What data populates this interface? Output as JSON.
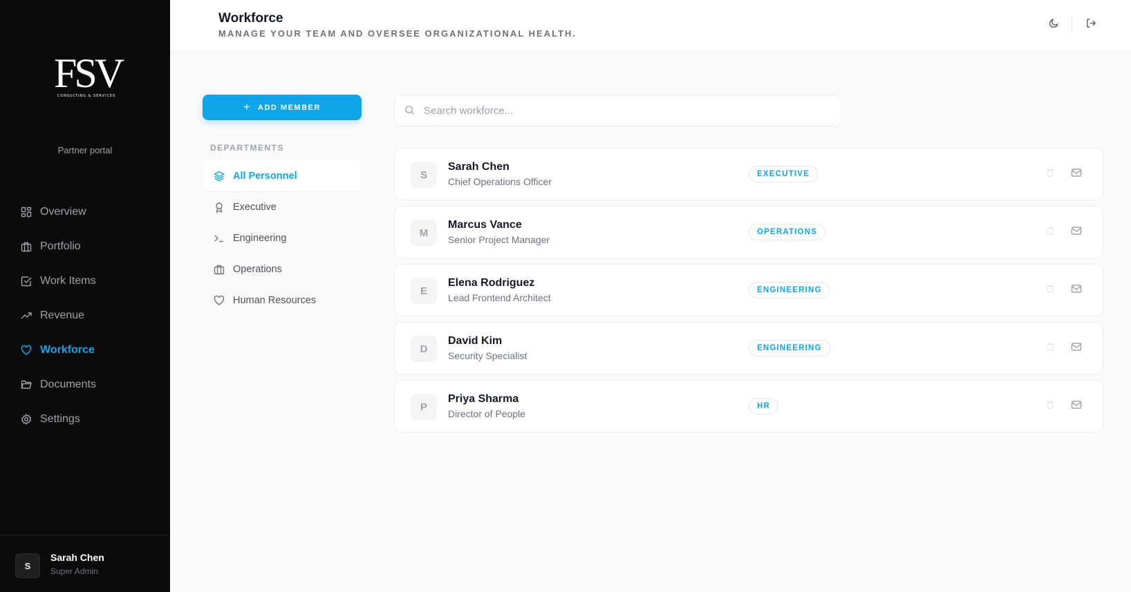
{
  "sidebar": {
    "logo_text": "FSV",
    "logo_subtext": "CONSULTING & SERVICES",
    "partner_label": "Partner portal",
    "nav": [
      {
        "label": "Overview",
        "icon": "grid-icon"
      },
      {
        "label": "Portfolio",
        "icon": "briefcase-icon"
      },
      {
        "label": "Work Items",
        "icon": "checkbox-icon"
      },
      {
        "label": "Revenue",
        "icon": "trending-up-icon"
      },
      {
        "label": "Workforce",
        "icon": "heart-icon",
        "active": true
      },
      {
        "label": "Documents",
        "icon": "folder-icon"
      },
      {
        "label": "Settings",
        "icon": "gear-icon"
      }
    ],
    "user": {
      "initial": "S",
      "name": "Sarah Chen",
      "role": "Super Admin"
    }
  },
  "header": {
    "title": "Workforce",
    "subtitle": "MANAGE YOUR TEAM AND OVERSEE ORGANIZATIONAL HEALTH.",
    "theme_icon": "moon-icon",
    "logout_icon": "logout-icon"
  },
  "left_panel": {
    "add_button": "ADD MEMBER",
    "departments_heading": "DEPARTMENTS",
    "departments": [
      {
        "label": "All Personnel",
        "icon": "layers-icon",
        "active": true
      },
      {
        "label": "Executive",
        "icon": "award-icon"
      },
      {
        "label": "Engineering",
        "icon": "terminal-icon"
      },
      {
        "label": "Operations",
        "icon": "briefcase-icon"
      },
      {
        "label": "Human Resources",
        "icon": "heart-icon"
      }
    ]
  },
  "search": {
    "placeholder": "Search workforce..."
  },
  "members": [
    {
      "initial": "S",
      "name": "Sarah Chen",
      "role": "Chief Operations Officer",
      "department": "EXECUTIVE"
    },
    {
      "initial": "M",
      "name": "Marcus Vance",
      "role": "Senior Project Manager",
      "department": "OPERATIONS"
    },
    {
      "initial": "E",
      "name": "Elena Rodriguez",
      "role": "Lead Frontend Architect",
      "department": "ENGINEERING"
    },
    {
      "initial": "D",
      "name": "David Kim",
      "role": "Security Specialist",
      "department": "ENGINEERING"
    },
    {
      "initial": "P",
      "name": "Priya Sharma",
      "role": "Director of People",
      "department": "HR"
    }
  ],
  "colors": {
    "accent": "#0ea5e9",
    "sidebar_bg": "#0b0b0b",
    "page_bg": "#fafafa"
  }
}
